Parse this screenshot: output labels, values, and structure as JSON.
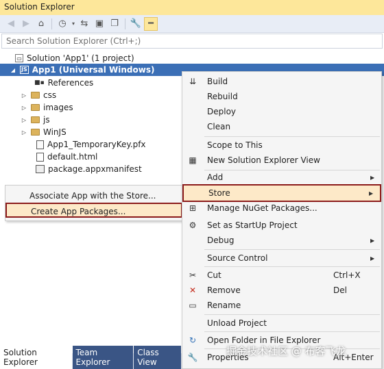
{
  "window": {
    "title": "Solution Explorer"
  },
  "toolbar": {
    "icons": [
      "back-icon",
      "forward-icon",
      "home-icon",
      "history-icon",
      "sync-icon",
      "collapse-icon",
      "copy-icon",
      "properties-icon",
      "pin-icon"
    ]
  },
  "search": {
    "placeholder": "Search Solution Explorer (Ctrl+;)"
  },
  "tree": {
    "solution": "Solution 'App1' (1 project)",
    "project": "App1 (Universal Windows)",
    "items": [
      {
        "label": "References"
      },
      {
        "label": "css"
      },
      {
        "label": "images"
      },
      {
        "label": "js"
      },
      {
        "label": "WinJS"
      },
      {
        "label": "App1_TemporaryKey.pfx"
      },
      {
        "label": "default.html"
      },
      {
        "label": "package.appxmanifest"
      }
    ]
  },
  "bottom_tabs": [
    "Solution Explorer",
    "Team Explorer",
    "Class View"
  ],
  "submenu": {
    "items": [
      {
        "label": "Associate App with the Store..."
      },
      {
        "label": "Create App Packages..."
      }
    ]
  },
  "context_menu": {
    "items": [
      {
        "label": "Build"
      },
      {
        "label": "Rebuild"
      },
      {
        "label": "Deploy"
      },
      {
        "label": "Clean"
      },
      {
        "label": "Scope to This"
      },
      {
        "label": "New Solution Explorer View"
      },
      {
        "label": "Add"
      },
      {
        "label": "Store"
      },
      {
        "label": "Manage NuGet Packages..."
      },
      {
        "label": "Set as StartUp Project"
      },
      {
        "label": "Debug"
      },
      {
        "label": "Source Control"
      },
      {
        "label": "Cut",
        "shortcut": "Ctrl+X"
      },
      {
        "label": "Remove",
        "shortcut": "Del"
      },
      {
        "label": "Rename"
      },
      {
        "label": "Unload Project"
      },
      {
        "label": "Open Folder in File Explorer"
      },
      {
        "label": "Properties",
        "shortcut": "Alt+Enter"
      }
    ]
  },
  "watermark": "掘金技术社区 @ 布客飞龙",
  "colors": {
    "accent": "#3b6fb6",
    "highlight_border": "#8b1a1a",
    "title_bar": "#fde79a"
  }
}
